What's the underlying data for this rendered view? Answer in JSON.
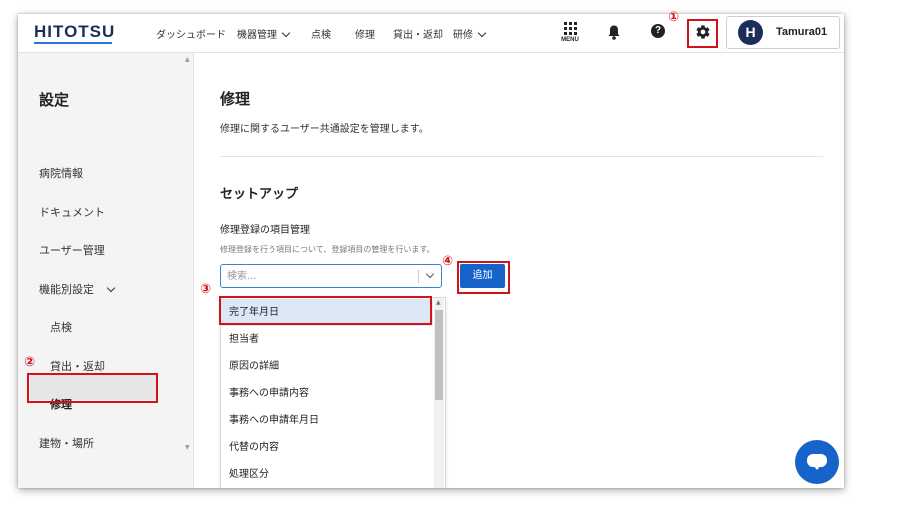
{
  "header": {
    "logo": "HITOTSU",
    "nav": [
      "ダッシュボード",
      "機器管理",
      "点検",
      "修理",
      "貸出・返却",
      "研修"
    ],
    "menu_label": "MENU",
    "help_symbol": "?",
    "avatar_letter": "H",
    "username": "Tamura01"
  },
  "sidebar": {
    "title": "設定",
    "items": [
      "病院情報",
      "ドキュメント",
      "ユーザー管理",
      "機能別設定",
      "点検",
      "貸出・返却",
      "修理",
      "建物・場所"
    ],
    "active": "修理"
  },
  "main": {
    "title": "修理",
    "description": "修理に関するユーザー共通設定を管理します。",
    "section_title": "セットアップ",
    "field_label": "修理登録の項目管理",
    "field_desc": "修理登録を行う項目について、登録項目の管理を行います。",
    "search_placeholder": "検索...",
    "add_button": "追加",
    "dropdown_items": [
      "完了年月日",
      "担当者",
      "原因の詳細",
      "事務への申請内容",
      "事務への申請年月日",
      "代替の内容",
      "処理区分"
    ],
    "selected_item": "完了年月日"
  },
  "annotations": {
    "markers": [
      "①",
      "②",
      "③",
      "④"
    ],
    "color": "#d0121b"
  },
  "colors": {
    "brand": "#1b2e5a",
    "primary": "#1664c9",
    "selection": "#dde8f6"
  }
}
